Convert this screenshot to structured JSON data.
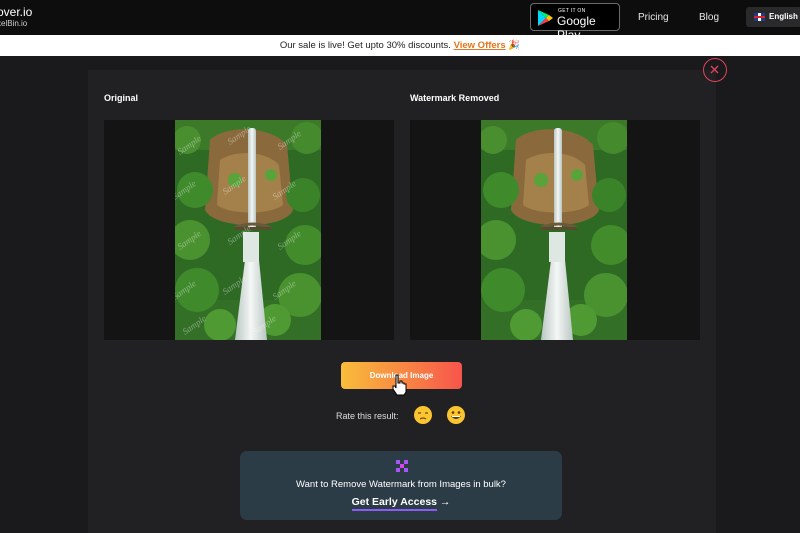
{
  "brand": {
    "name": "over.io",
    "sub": "xelBin.io"
  },
  "header": {
    "google_play_small": "GET IT ON",
    "google_play_big": "Google Play",
    "nav": [
      {
        "label": "Pricing"
      },
      {
        "label": "Blog"
      }
    ],
    "language": "English"
  },
  "banner": {
    "text": "Our sale is live! Get upto 30% discounts.",
    "link": "View Offers",
    "emoji": "🎉"
  },
  "compare": {
    "original_label": "Original",
    "removed_label": "Watermark Removed",
    "watermark_text": "Sample"
  },
  "actions": {
    "download": "Download Image",
    "rate_label": "Rate this result:"
  },
  "promo": {
    "question": "Want to Remove Watermark from Images in bulk?",
    "cta": "Get Early Access",
    "arrow": "→"
  },
  "colors": {
    "accent_orange": "#f9bd3b",
    "accent_red": "#f7554b",
    "close_ring": "#e0425c",
    "promo_bg": "#2c3c47",
    "link_orange": "#e0761c"
  }
}
